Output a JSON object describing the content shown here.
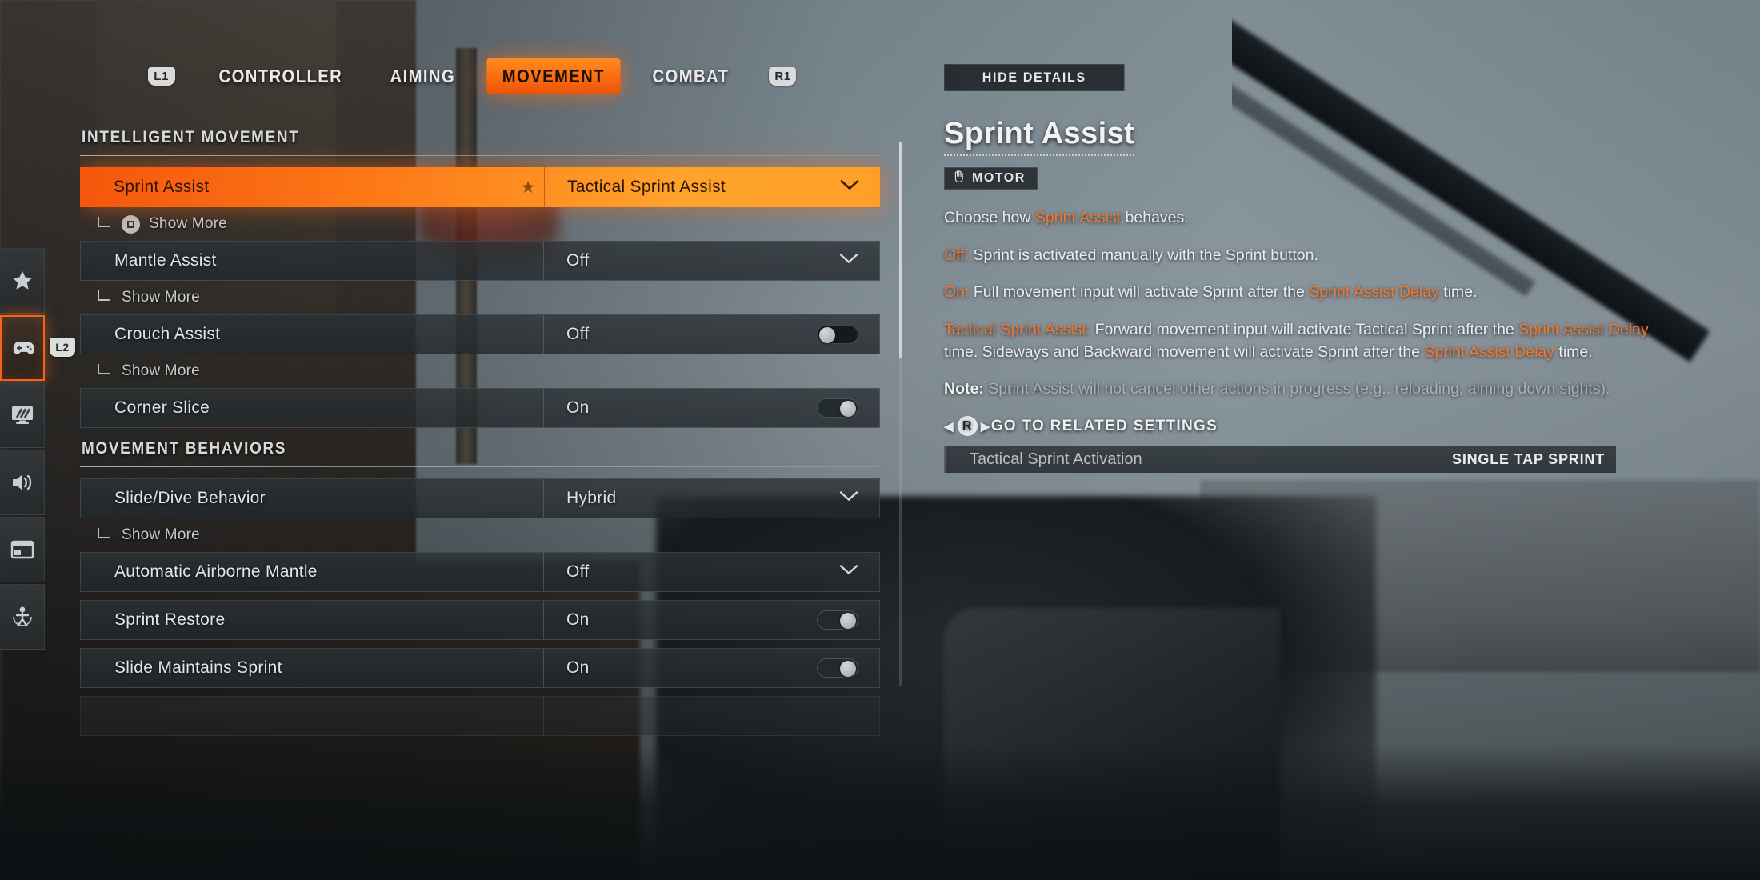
{
  "nav": {
    "left_bumper": "L1",
    "right_bumper": "R1",
    "tabs": [
      {
        "label": "CONTROLLER",
        "active": false
      },
      {
        "label": "AIMING",
        "active": false
      },
      {
        "label": "MOVEMENT",
        "active": true
      },
      {
        "label": "COMBAT",
        "active": false
      }
    ]
  },
  "rail": {
    "badge": "L2",
    "items": [
      {
        "icon": "star-icon",
        "active": false
      },
      {
        "icon": "gamepad-icon",
        "active": true
      },
      {
        "icon": "display-icon",
        "active": false
      },
      {
        "icon": "speaker-icon",
        "active": false
      },
      {
        "icon": "interface-icon",
        "active": false
      },
      {
        "icon": "accessibility-icon",
        "active": false
      }
    ]
  },
  "list": {
    "sections": [
      {
        "title": "INTELLIGENT MOVEMENT",
        "rows": [
          {
            "label": "Sprint Assist",
            "value": "Tactical Sprint Assist",
            "control": "dropdown",
            "selected": true,
            "favorited": true,
            "sub": "Show More",
            "sub_button": true
          },
          {
            "label": "Mantle Assist",
            "value": "Off",
            "control": "dropdown",
            "selected": false,
            "favorited": false,
            "sub": "Show More",
            "sub_button": false
          },
          {
            "label": "Crouch Assist",
            "value": "Off",
            "control": "toggle-off",
            "selected": false,
            "favorited": false,
            "sub": "Show More",
            "sub_button": false
          },
          {
            "label": "Corner Slice",
            "value": "On",
            "control": "toggle-on",
            "selected": false,
            "favorited": false,
            "sub": null,
            "sub_button": false
          }
        ]
      },
      {
        "title": "MOVEMENT BEHAVIORS",
        "rows": [
          {
            "label": "Slide/Dive Behavior",
            "value": "Hybrid",
            "control": "dropdown",
            "selected": false,
            "favorited": false,
            "sub": "Show More",
            "sub_button": false
          },
          {
            "label": "Automatic Airborne Mantle",
            "value": "Off",
            "control": "dropdown",
            "selected": false,
            "favorited": false,
            "sub": null,
            "sub_button": false
          },
          {
            "label": "Sprint Restore",
            "value": "On",
            "control": "toggle-on",
            "selected": false,
            "favorited": false,
            "sub": null,
            "sub_button": false
          },
          {
            "label": "Slide Maintains Sprint",
            "value": "On",
            "control": "toggle-on",
            "selected": false,
            "favorited": false,
            "sub": null,
            "sub_button": false
          }
        ]
      }
    ]
  },
  "details": {
    "hide_button": "HIDE DETAILS",
    "title": "Sprint Assist",
    "tag_icon": "hand-icon",
    "tag_label": "MOTOR",
    "paragraphs": {
      "intro_pre": "Choose how ",
      "intro_hl": "Sprint Assist",
      "intro_post": " behaves.",
      "off_key": "Off:",
      "off_text": " Sprint is activated manually with the Sprint button.",
      "on_key": "On:",
      "on_text_a": " Full movement input will activate Sprint after the ",
      "on_hl": "Sprint Assist Delay",
      "on_text_b": " time.",
      "tsa_key": "Tactical Sprint Assist:",
      "tsa_text_a": " Forward movement input will activate Tactical Sprint after the ",
      "tsa_hl_1": "Sprint Assist Delay",
      "tsa_text_b": " time. Sideways and Backward movement will activate Sprint after the ",
      "tsa_hl_2": "Sprint Assist Delay",
      "tsa_text_c": " time.",
      "note_key": "Note:",
      "note_text": " Sprint Assist will not cancel other actions in progress (e.g.: reloading, aiming down sights)."
    },
    "related": {
      "button": "R",
      "heading": "GO TO RELATED SETTINGS",
      "rows": [
        {
          "name": "Tactical Sprint Activation",
          "value": "SINGLE TAP SPRINT"
        }
      ]
    }
  },
  "colors": {
    "accent": "#f4631a",
    "accent_text": "#f4772a",
    "panel": "#262b2e",
    "text": "#e9ecee"
  }
}
